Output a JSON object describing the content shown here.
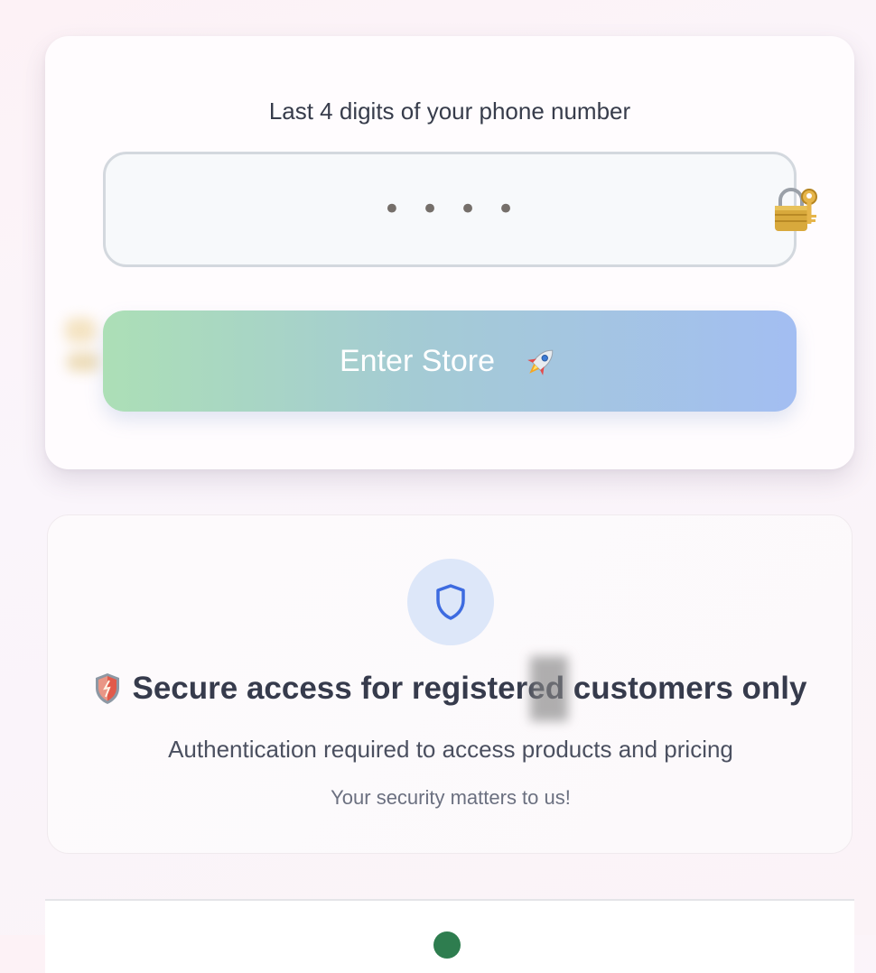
{
  "login_form": {
    "label": "Last 4 digits of your phone number",
    "pin_value": "",
    "pin_placeholder": "••••",
    "lock_icon": "lock-with-key-icon",
    "submit_label": "Enter Store",
    "submit_icon": "rocket-icon",
    "colors": {
      "button_gradient_start": "#acdfb6",
      "button_gradient_end": "#a3bef2"
    }
  },
  "info": {
    "badge_icon": "shield-outline-icon",
    "title_icon": "shield-emoji-icon",
    "title": "Secure access for registered customers only",
    "subtitle": "Authentication required to access products and pricing",
    "note": "Your security matters to us!",
    "colors": {
      "badge_bg": "#dde7f9",
      "badge_icon": "#3d6be0"
    }
  }
}
